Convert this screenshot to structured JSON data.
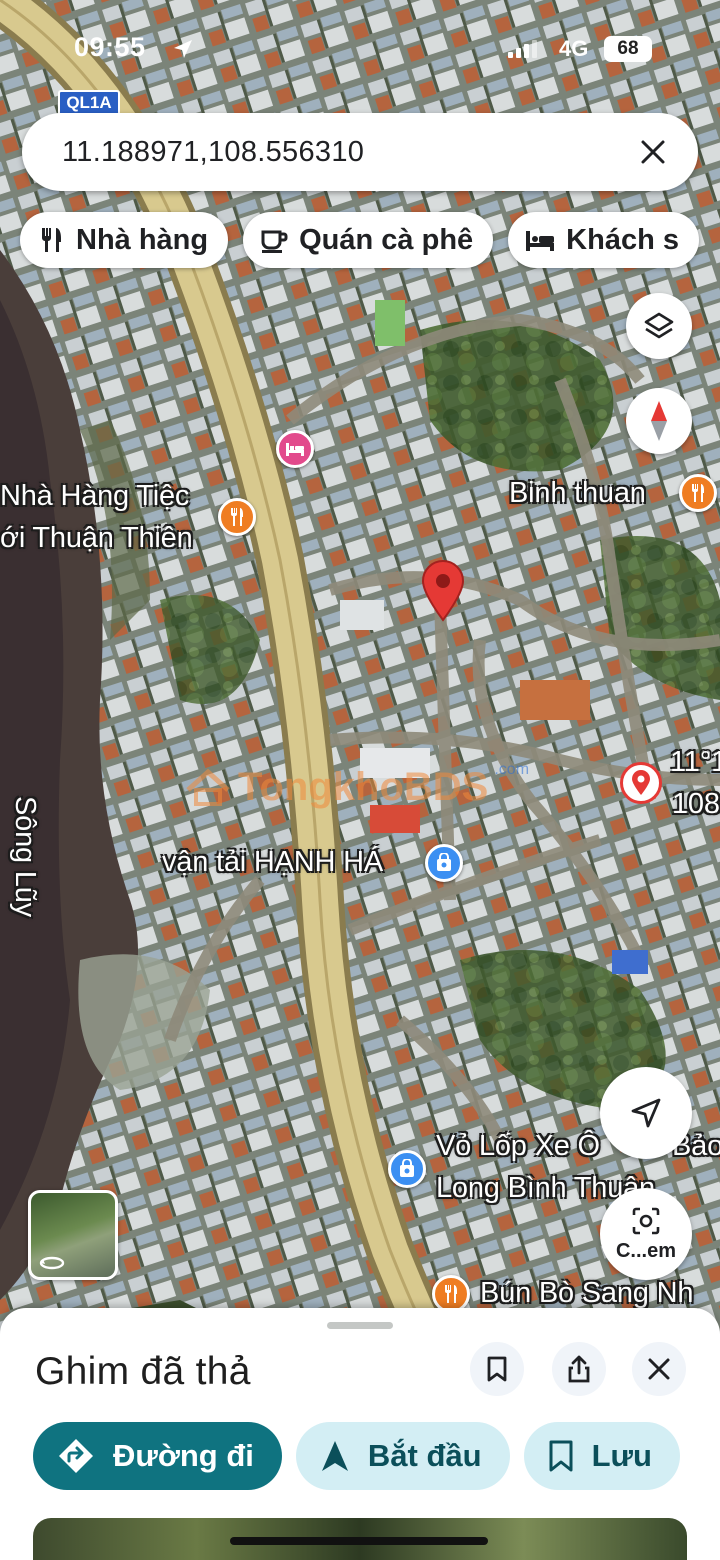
{
  "status_bar": {
    "time": "09:55",
    "network": "4G",
    "battery": "68"
  },
  "search": {
    "query": "11.188971,108.556310"
  },
  "chips": [
    {
      "label": "Nhà hàng",
      "icon": "restaurant-icon"
    },
    {
      "label": "Quán cà phê",
      "icon": "coffee-icon"
    },
    {
      "label": "Khách s",
      "icon": "hotel-icon"
    }
  ],
  "map": {
    "route_shield": "QL1A",
    "labels": {
      "restaurant_left_line1": "Nhà Hàng Tiệc",
      "restaurant_left_line2": "ới Thuận Thiên",
      "binh_thuan": "Binh thuan",
      "coord_line1": "11°1",
      "coord_line2": "108",
      "van_tai": "vận tải HẠNH HÁ",
      "song_luy": "Sông Lũy",
      "vo_lop_line1": "Vỏ Lốp Xe Ô",
      "vo_lop_line1_b": "Bảo",
      "vo_lop_line2": "Long Bình Thuận",
      "bun_bo": "Bún Bò Sang Nh",
      "watermark": "TongkhoBDS",
      "watermark_small": ".com"
    },
    "lens_label": "C...em"
  },
  "sheet": {
    "title": "Ghim đã thả",
    "actions": [
      {
        "label": "Đường đi",
        "icon": "directions-icon"
      },
      {
        "label": "Bắt đầu",
        "icon": "navigation-arrow-icon"
      },
      {
        "label": "Lưu",
        "icon": "bookmark-icon"
      }
    ]
  },
  "colors": {
    "primary": "#0f7380",
    "secondary": "#d3eef4",
    "pin": "#e53935",
    "road": "#c9b878"
  }
}
